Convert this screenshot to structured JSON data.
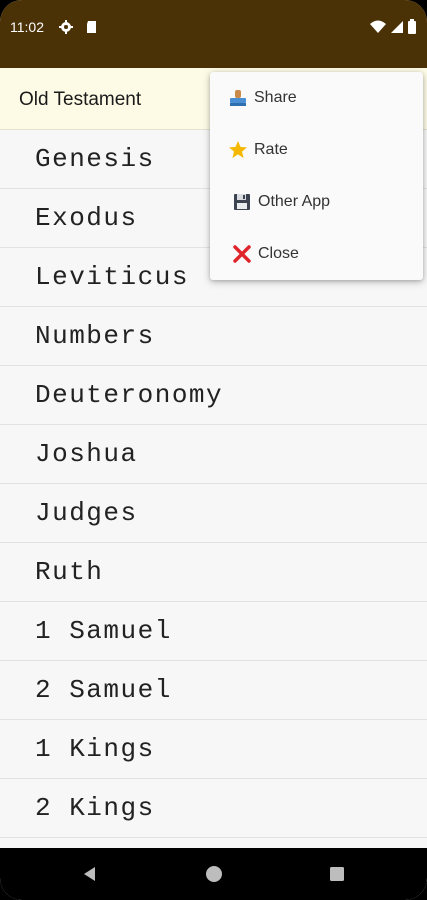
{
  "status_bar": {
    "time": "11:02",
    "icons_left": [
      "gear-icon",
      "sd-card-icon"
    ],
    "icons_right": [
      "wifi-icon",
      "signal-icon",
      "battery-icon"
    ],
    "background": "#4a3206"
  },
  "app_bar": {
    "title": "Old Testament",
    "background": "#fdfbe6"
  },
  "books": [
    "Genesis",
    "Exodus",
    "Leviticus",
    "Numbers",
    "Deuteronomy",
    "Joshua",
    "Judges",
    "Ruth",
    "1 Samuel",
    "2 Samuel",
    "1 Kings",
    "2 Kings"
  ],
  "menu": {
    "items": [
      {
        "label": "Share",
        "icon": "share-stamp-icon"
      },
      {
        "label": "Rate",
        "icon": "star-icon"
      },
      {
        "label": "Other App",
        "icon": "floppy-disk-icon"
      },
      {
        "label": "Close",
        "icon": "close-x-icon"
      }
    ]
  },
  "nav_bar": {
    "buttons": [
      "back-icon",
      "home-icon",
      "recents-icon"
    ]
  }
}
